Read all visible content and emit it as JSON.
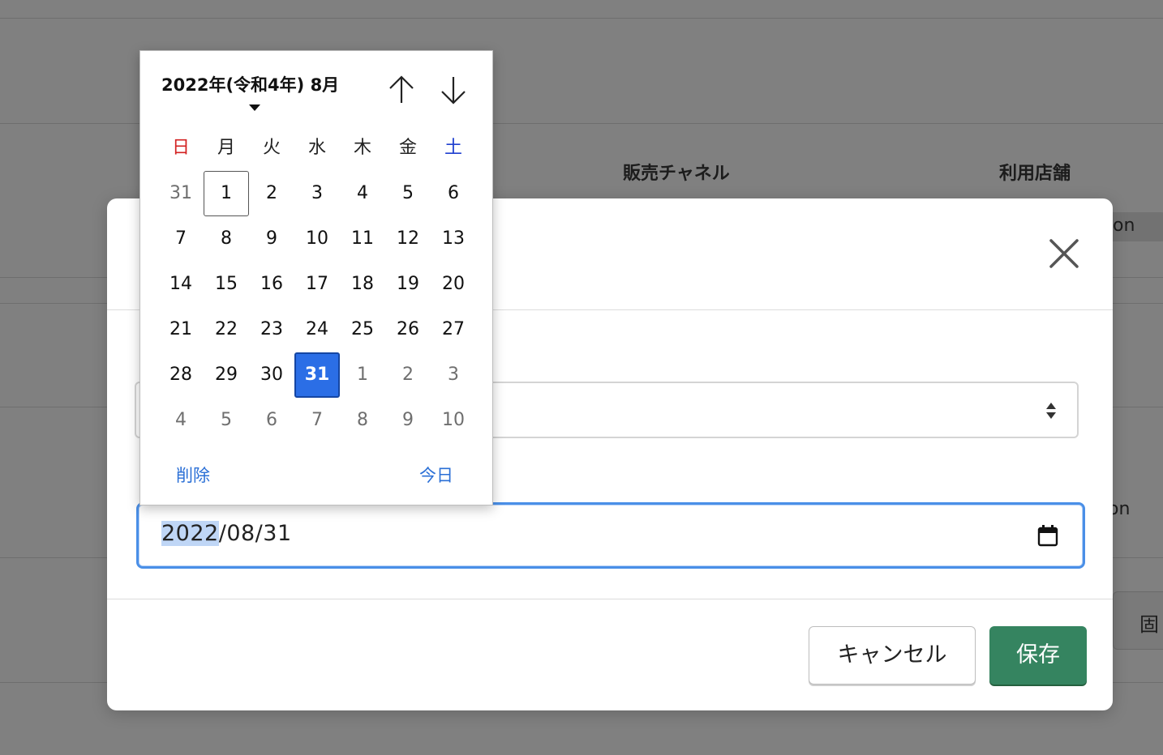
{
  "background": {
    "col_sales_channel": "販売チャネル",
    "col_store": "利用店舗",
    "partial_text_1": "on",
    "partial_text_2": "on",
    "partial_button": "固"
  },
  "date_field": {
    "value_year": "2022",
    "value_rest": "/08/31"
  },
  "buttons": {
    "cancel": "キャンセル",
    "save": "保存"
  },
  "calendar": {
    "title": "2022年(令和4年) 8月",
    "weekdays": [
      "日",
      "月",
      "火",
      "水",
      "木",
      "金",
      "土"
    ],
    "weeks": [
      [
        "31",
        "1",
        "2",
        "3",
        "4",
        "5",
        "6"
      ],
      [
        "7",
        "8",
        "9",
        "10",
        "11",
        "12",
        "13"
      ],
      [
        "14",
        "15",
        "16",
        "17",
        "18",
        "19",
        "20"
      ],
      [
        "21",
        "22",
        "23",
        "24",
        "25",
        "26",
        "27"
      ],
      [
        "28",
        "29",
        "30",
        "31",
        "1",
        "2",
        "3"
      ],
      [
        "4",
        "5",
        "6",
        "7",
        "8",
        "9",
        "10"
      ]
    ],
    "clear_label": "削除",
    "today_label": "今日"
  },
  "colors": {
    "accent": "#2b6ee6",
    "save_green": "#358460",
    "sunday": "#d32222",
    "saturday": "#1e3fcf",
    "link": "#2a6fd6"
  }
}
